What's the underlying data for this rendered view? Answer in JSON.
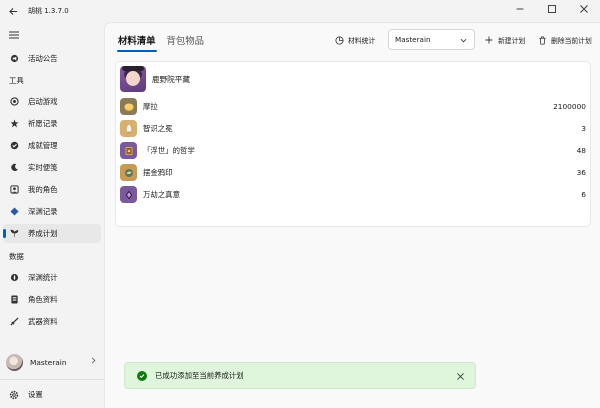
{
  "app": {
    "title": "胡桃 1.3.7.0"
  },
  "sidebar": {
    "items_top": [
      {
        "label": "活动公告",
        "icon": "megaphone-icon"
      }
    ],
    "section_tools": "工具",
    "tools": [
      {
        "label": "启动游戏",
        "icon": "game-launch-icon"
      },
      {
        "label": "祈愿记录",
        "icon": "wish-icon"
      },
      {
        "label": "成就管理",
        "icon": "achievement-icon"
      },
      {
        "label": "实时便笺",
        "icon": "moon-note-icon"
      },
      {
        "label": "我的角色",
        "icon": "character-icon"
      },
      {
        "label": "深渊记录",
        "icon": "abyss-icon"
      },
      {
        "label": "养成计划",
        "icon": "cultivation-icon",
        "selected": true
      }
    ],
    "section_data": "数据",
    "data": [
      {
        "label": "深渊统计",
        "icon": "abyss-stats-icon"
      },
      {
        "label": "角色资料",
        "icon": "character-wiki-icon"
      },
      {
        "label": "武器资料",
        "icon": "weapon-wiki-icon"
      }
    ],
    "user": {
      "name": "Masterain"
    },
    "settings_label": "设置"
  },
  "content": {
    "tabs": [
      {
        "label": "材料清单",
        "active": true
      },
      {
        "label": "背包物品",
        "active": false
      }
    ],
    "toolbar": {
      "stats_label": "材料统计",
      "project_selected": "Masterain",
      "new_plan_label": "新建计划",
      "delete_plan_label": "删除当前计划"
    },
    "character": {
      "name": "鹿野院平藏"
    },
    "materials": [
      {
        "name": "摩拉",
        "count": "2100000",
        "icon": "mora-icon",
        "bg": "#8a7a5a"
      },
      {
        "name": "智识之冕",
        "count": "3",
        "icon": "crown-icon",
        "bg": "#d7b070"
      },
      {
        "name": "「浮世」的哲学",
        "count": "48",
        "icon": "philosophy-book-icon",
        "bg": "#7a5a9a"
      },
      {
        "name": "摆金鸦印",
        "count": "36",
        "icon": "crow-insignia-icon",
        "bg": "#c79a55"
      },
      {
        "name": "万劫之真意",
        "count": "6",
        "icon": "boss-material-icon",
        "bg": "#7a5a9a"
      }
    ]
  },
  "toast": {
    "message": "已成功添加至当前养成计划"
  },
  "colors": {
    "accent": "#005fb8",
    "success": "#0f7b0f",
    "toast_bg": "#dff6dd"
  }
}
